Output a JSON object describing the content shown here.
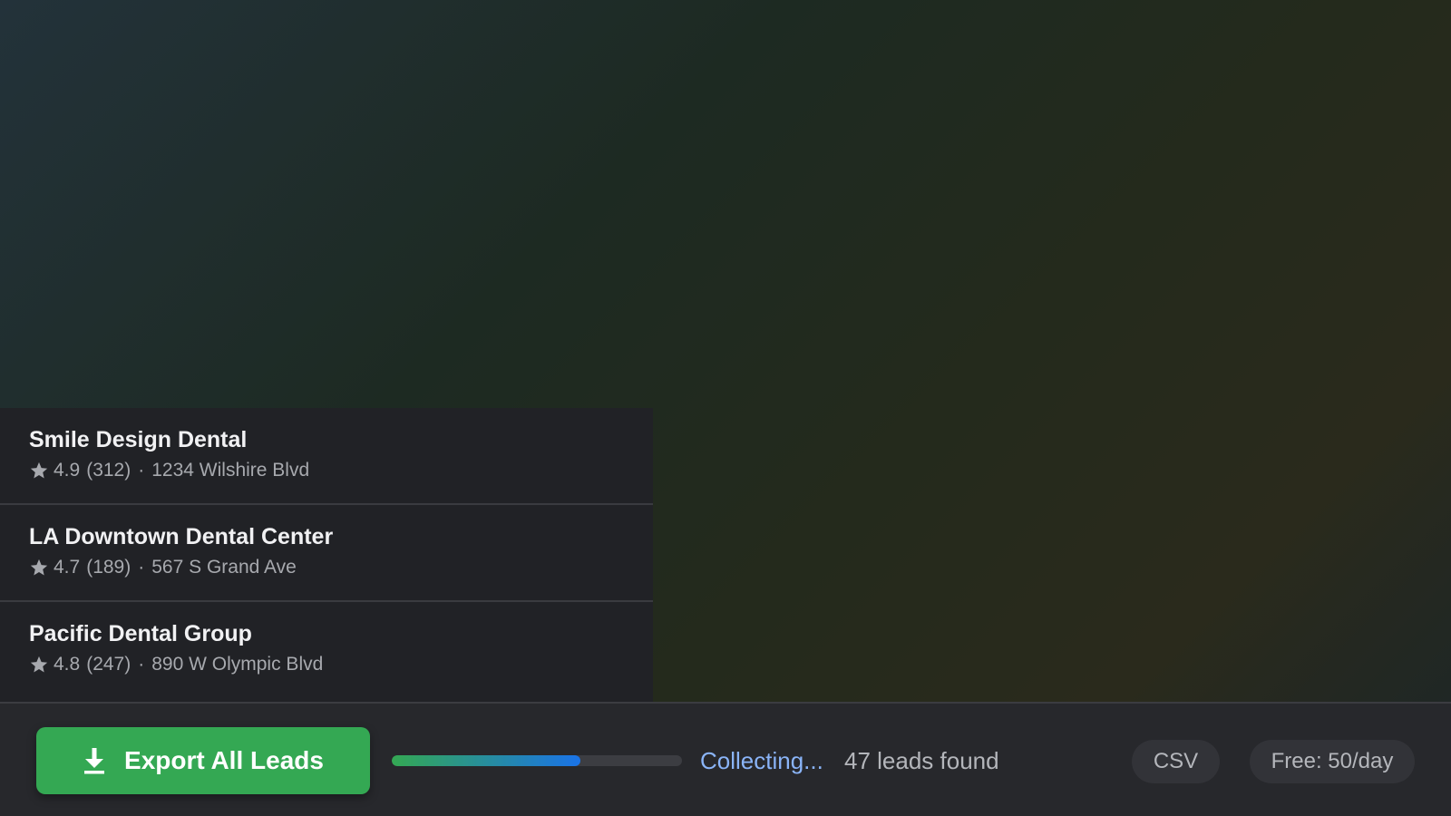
{
  "results": [
    {
      "name": "Smile Design Dental",
      "rating": "4.9",
      "reviews": "(312)",
      "address": "1234 Wilshire Blvd"
    },
    {
      "name": "LA Downtown Dental Center",
      "rating": "4.7",
      "reviews": "(189)",
      "address": "567 S Grand Ave"
    },
    {
      "name": "Pacific Dental Group",
      "rating": "4.8",
      "reviews": "(247)",
      "address": "890 W Olympic Blvd"
    }
  ],
  "meta_separator": "·",
  "icons": {
    "rating": "star-icon",
    "export": "download-icon"
  },
  "bottom_bar": {
    "export_label": "Export All Leads",
    "progress": 0.65,
    "status": "Collecting...",
    "count": "47 leads found",
    "format": "CSV",
    "limit": "Free: 50/day"
  },
  "colors": {
    "accent_green": "#34a853",
    "accent_blue": "#1a73e8",
    "status_blue": "#8ab4f8",
    "panel_bg": "#212226",
    "bar_bg": "#27282c"
  }
}
